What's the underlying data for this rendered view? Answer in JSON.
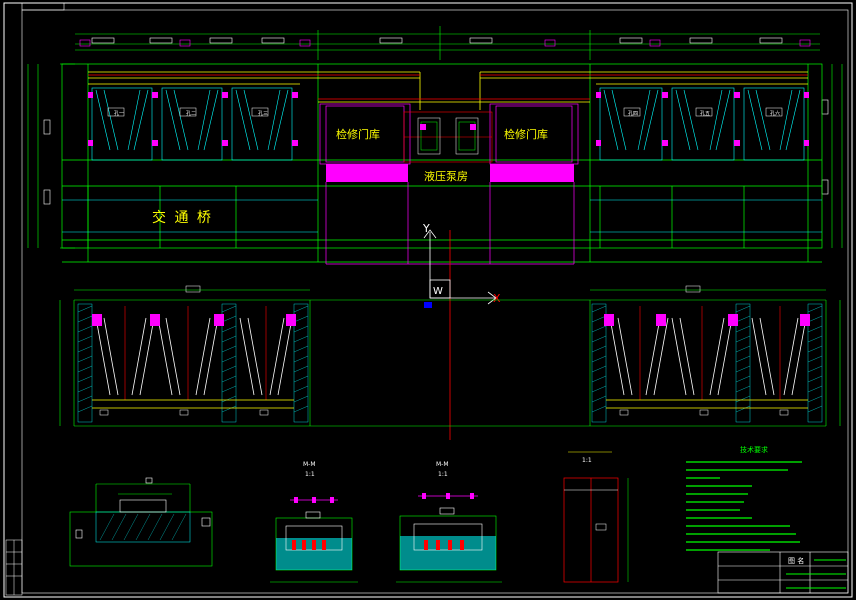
{
  "drawing": {
    "corner_label": "",
    "label_access_bridge": "交 通 桥",
    "label_maint_gate_left": "检修门库",
    "label_maint_gate_right": "检修门库",
    "label_hydraulic_room": "液压泵房",
    "axis_y": "Y",
    "axis_x": "X",
    "axis_w": "W",
    "section_a_title": "M-M",
    "section_a_scale": "1:1",
    "section_b_title": "M-M",
    "section_b_scale": "1:1",
    "detail_scale": "1:1",
    "tech_notes_title": "技术要求",
    "titleblock_label": "图 名"
  },
  "colors": {
    "background": "#000000",
    "yellow": "#ffff00",
    "green": "#00ff00",
    "cyan": "#00ffff",
    "magenta": "#ff00ff",
    "red": "#ff0000",
    "white": "#ffffff",
    "blue": "#0000ff"
  }
}
